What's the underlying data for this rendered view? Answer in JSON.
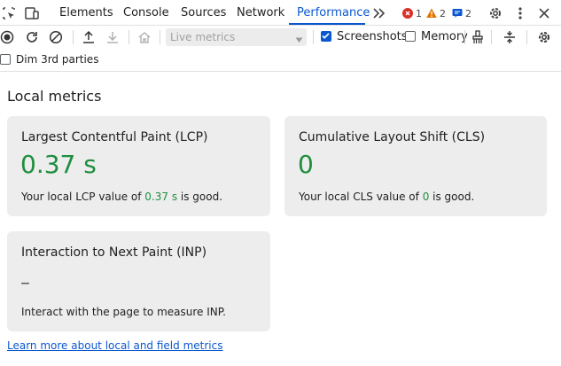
{
  "tabs": [
    {
      "label": "Elements"
    },
    {
      "label": "Console"
    },
    {
      "label": "Sources"
    },
    {
      "label": "Network"
    },
    {
      "label": "Performance"
    }
  ],
  "badges": {
    "errors": "1",
    "warnings": "2",
    "messages": "2"
  },
  "toolbar": {
    "live_metrics_select": "Live metrics",
    "screenshots_label": "Screenshots",
    "screenshots_checked": true,
    "memory_label": "Memory",
    "memory_checked": false,
    "dim_third_parties_label": "Dim 3rd parties",
    "dim_third_parties_checked": false
  },
  "main": {
    "section_title": "Local metrics",
    "lcp": {
      "title": "Largest Contentful Paint (LCP)",
      "value": "0.37 s",
      "desc_prefix": "Your local LCP value of ",
      "desc_value": "0.37 s",
      "desc_suffix": " is good."
    },
    "cls": {
      "title": "Cumulative Layout Shift (CLS)",
      "value": "0",
      "desc_prefix": "Your local CLS value of ",
      "desc_value": "0",
      "desc_suffix": " is good."
    },
    "inp": {
      "title": "Interaction to Next Paint (INP)",
      "value": "–",
      "desc": "Interact with the page to measure INP."
    },
    "learn_more_link": "Learn more about local and field metrics"
  },
  "colors": {
    "accent": "#0b57d0",
    "good": "#1e8e3e",
    "error": "#d93025",
    "warning": "#e37400",
    "card_bg": "#ededed"
  }
}
